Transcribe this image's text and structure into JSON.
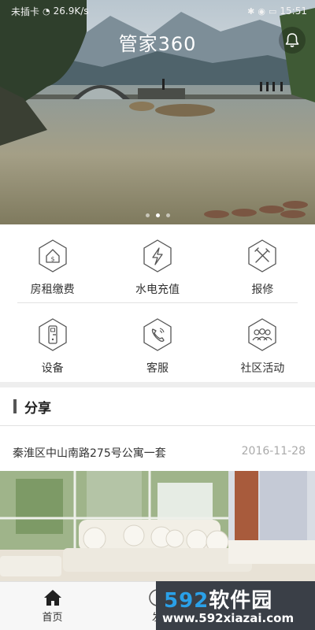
{
  "status_bar": {
    "carrier": "未插卡",
    "speed": "26.9K/s",
    "time": "15:51"
  },
  "header": {
    "app_title": "管家360",
    "bell_icon": "bell-icon",
    "carousel_pages": 3,
    "carousel_active": 2
  },
  "services": {
    "items": [
      {
        "label": "房租缴费",
        "icon": "house-money-icon"
      },
      {
        "label": "水电充值",
        "icon": "lightning-icon"
      },
      {
        "label": "报修",
        "icon": "tools-icon"
      },
      {
        "label": "设备",
        "icon": "door-lock-icon"
      },
      {
        "label": "客服",
        "icon": "phone-icon"
      },
      {
        "label": "社区活动",
        "icon": "people-icon"
      }
    ]
  },
  "share": {
    "title": "分享",
    "item": {
      "name": "秦淮区中山南路275号公寓一套",
      "date": "2016-11-28"
    }
  },
  "tabbar": {
    "tabs": [
      {
        "label": "首页",
        "icon": "home-icon",
        "active": true
      },
      {
        "label": "发",
        "icon": "compass-icon",
        "active": false
      }
    ]
  },
  "watermark": {
    "brand_number": "592",
    "brand_name": "软件园",
    "url": "www.592xiazai.com"
  },
  "colors": {
    "accent": "#2aa0e8",
    "icon_stroke": "#555555",
    "date_gray": "#aaaaaa"
  }
}
